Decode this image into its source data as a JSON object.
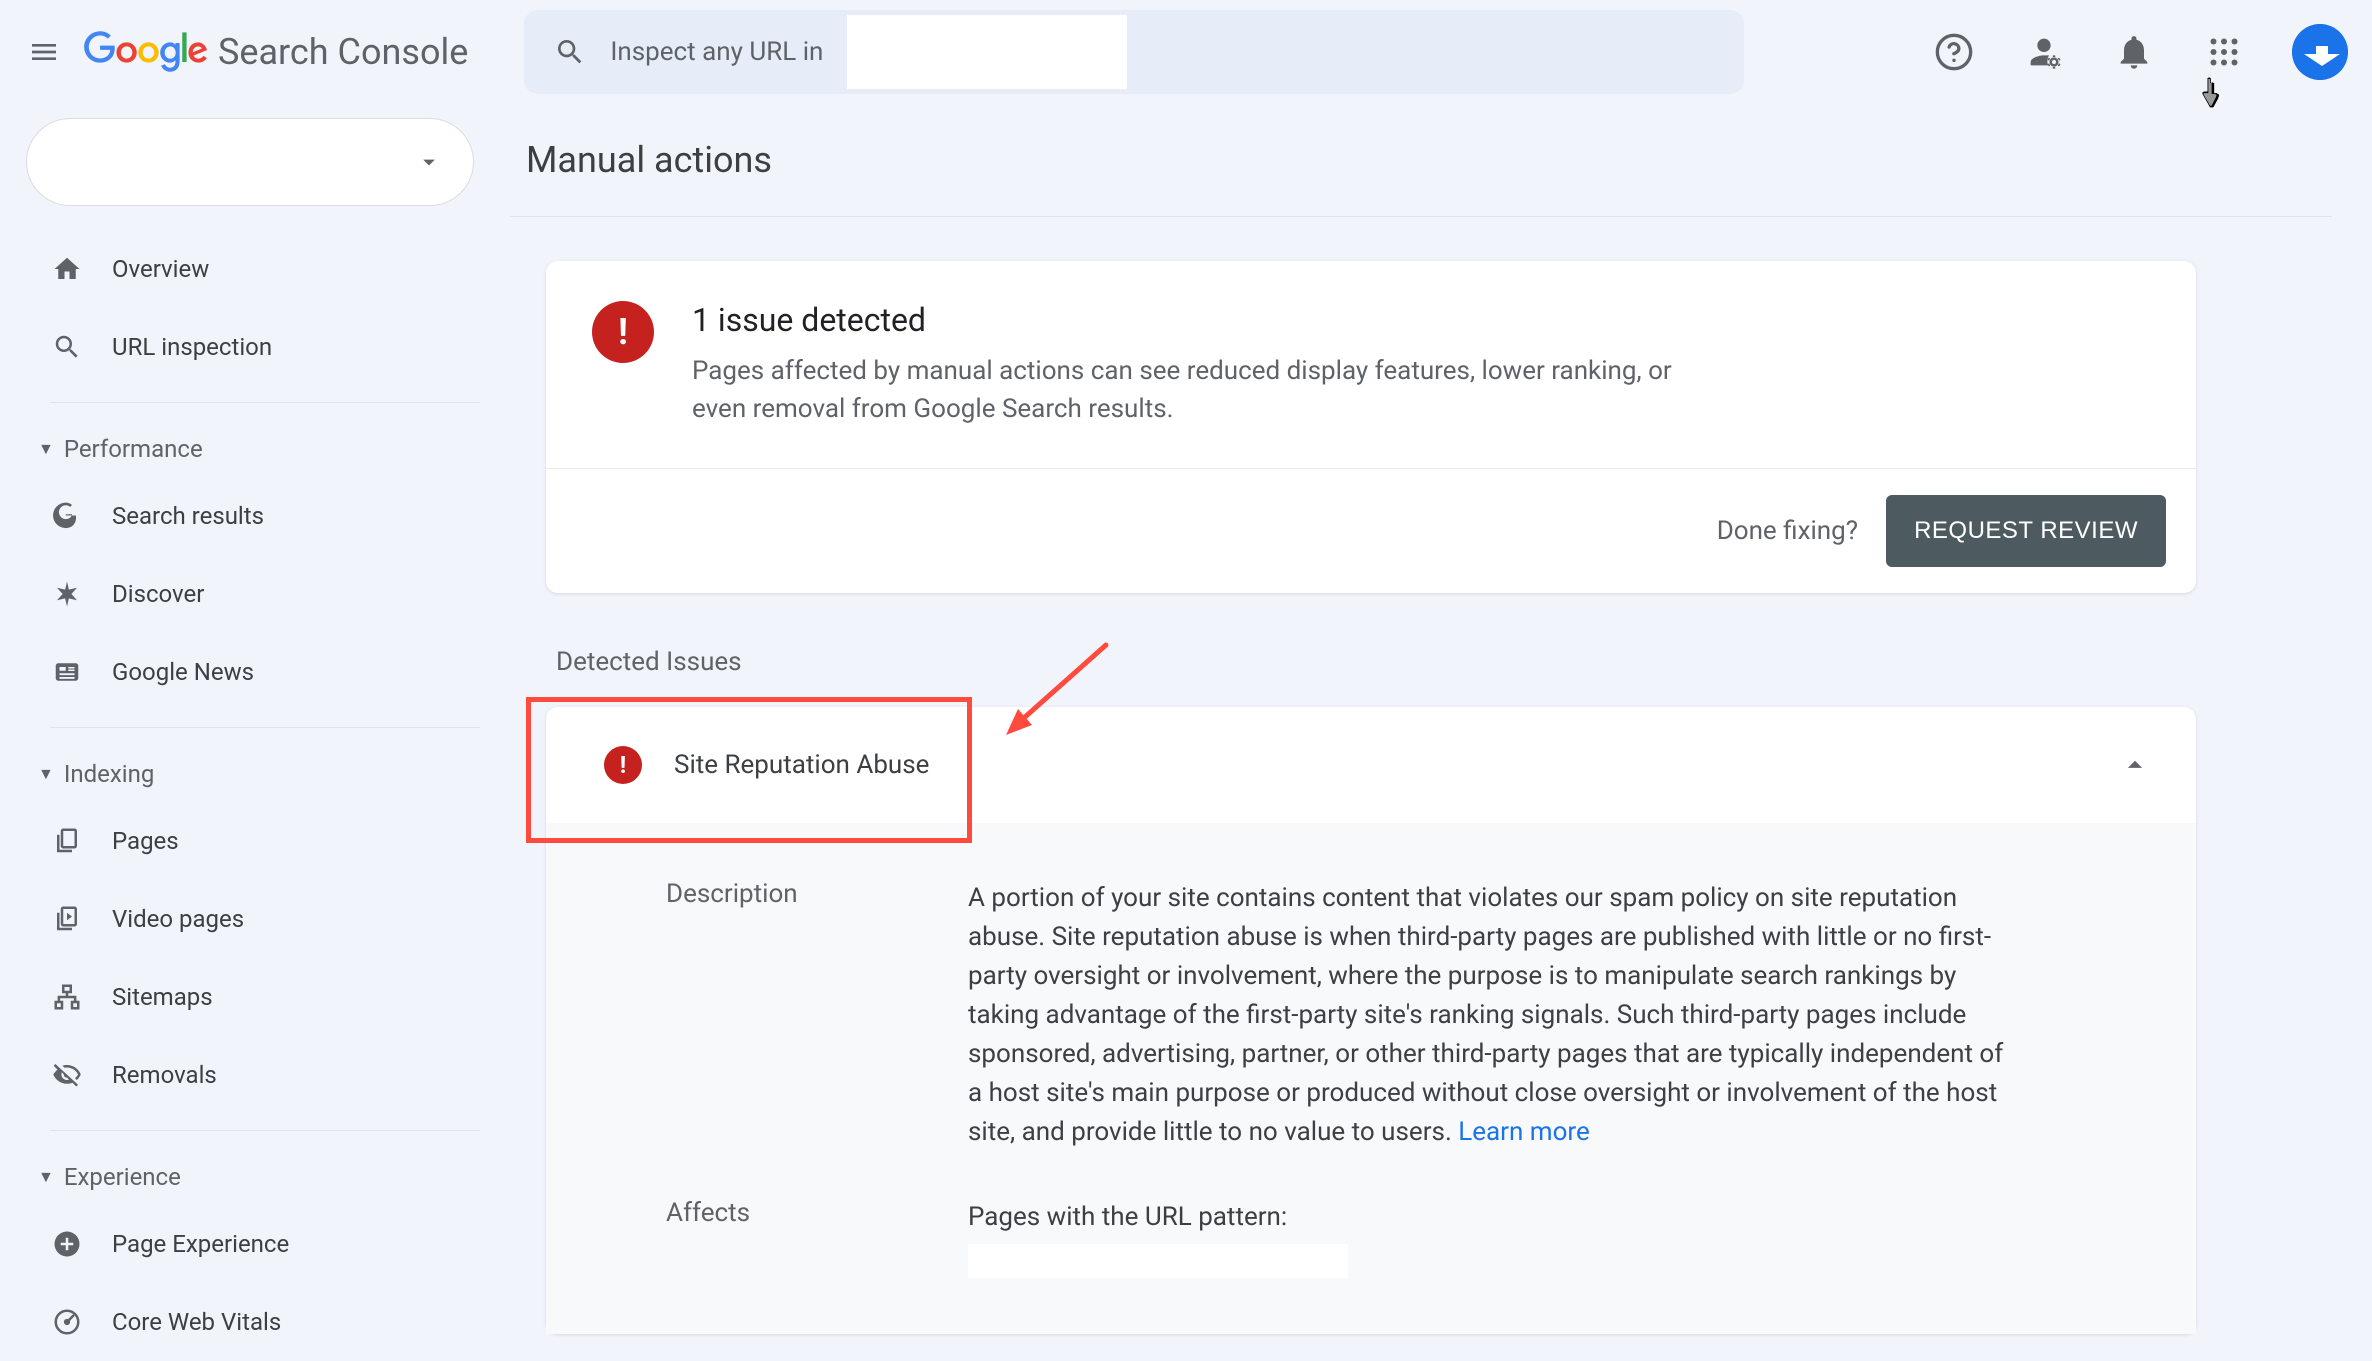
{
  "header": {
    "app_name": "Search Console",
    "search_prefix": "Inspect any URL in"
  },
  "sidebar": {
    "items": [
      {
        "type": "item",
        "label": "Overview",
        "icon": "home"
      },
      {
        "type": "item",
        "label": "URL inspection",
        "icon": "search"
      },
      {
        "type": "hr"
      },
      {
        "type": "group",
        "label": "Performance"
      },
      {
        "type": "item",
        "label": "Search results",
        "icon": "g"
      },
      {
        "type": "item",
        "label": "Discover",
        "icon": "asterisk"
      },
      {
        "type": "item",
        "label": "Google News",
        "icon": "news"
      },
      {
        "type": "hr"
      },
      {
        "type": "group",
        "label": "Indexing"
      },
      {
        "type": "item",
        "label": "Pages",
        "icon": "pages"
      },
      {
        "type": "item",
        "label": "Video pages",
        "icon": "video"
      },
      {
        "type": "item",
        "label": "Sitemaps",
        "icon": "sitemap"
      },
      {
        "type": "item",
        "label": "Removals",
        "icon": "eye-off"
      },
      {
        "type": "hr"
      },
      {
        "type": "group",
        "label": "Experience"
      },
      {
        "type": "item",
        "label": "Page Experience",
        "icon": "circle-plus"
      },
      {
        "type": "item",
        "label": "Core Web Vitals",
        "icon": "gauge"
      }
    ]
  },
  "page": {
    "title": "Manual actions",
    "summary": {
      "title": "1 issue detected",
      "description": "Pages affected by manual actions can see reduced display features, lower ranking, or even removal from Google Search results."
    },
    "actions": {
      "done_label": "Done fixing?",
      "request_review": "REQUEST REVIEW"
    },
    "detected": {
      "section_label": "Detected Issues",
      "issue_title": "Site Reputation Abuse",
      "description_label": "Description",
      "description_text": "A portion of your site contains content that violates our spam policy on site reputation abuse. Site reputation abuse is when third-party pages are published with little or no first-party oversight or involvement, where the purpose is to manipulate search rankings by taking advantage of the first-party site's ranking signals. Such third-party pages include sponsored, advertising, partner, or other third-party pages that are typically independent of a host site's main purpose or produced without close oversight or involvement of the host site, and provide little to no value to users. ",
      "learn_more": "Learn more",
      "affects_label": "Affects",
      "affects_text": "Pages with the URL pattern:"
    }
  }
}
